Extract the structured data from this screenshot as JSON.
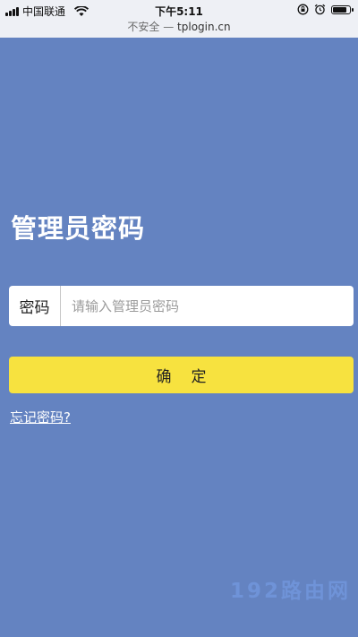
{
  "status_bar": {
    "carrier": "中国联通",
    "time": "下午5:11",
    "battery_level": 0.9,
    "icons": [
      "signal-icon",
      "wifi-icon",
      "orientation-lock-icon",
      "alarm-icon",
      "battery-icon"
    ]
  },
  "url_bar": {
    "security": "不安全",
    "separator": "—",
    "domain": "tplogin.cn"
  },
  "login": {
    "title": "管理员密码",
    "password_label": "密码",
    "password_placeholder": "请输入管理员密码",
    "password_value": "",
    "confirm_label": "确定",
    "forgot_label": "忘记密码?"
  },
  "watermark": "192路由网",
  "colors": {
    "background": "#6483c1",
    "button": "#f7e23f",
    "status_bar": "#eef0f5"
  }
}
